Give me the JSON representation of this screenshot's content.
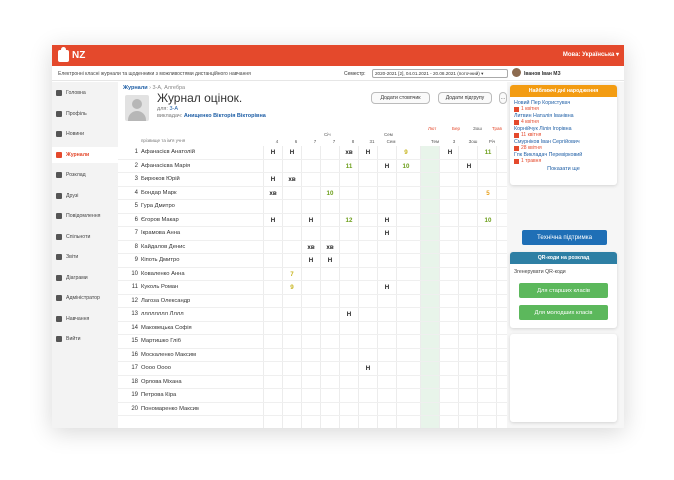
{
  "header": {
    "logo": "NZ",
    "language": "Мова: Українська ▾"
  },
  "subbar": {
    "info": "Електронні класні журнали та щоденники з можливостями дистанційного навчання",
    "semester_label": "Семестр:",
    "semester_value": "2020-2021 [2], 04.01.2021 - 20.08.2021 (поточний) ▾",
    "user": "Іванов Іван МЗ"
  },
  "sidebar": {
    "items": [
      {
        "label": "Головна",
        "icon": "home-icon"
      },
      {
        "label": "Профіль",
        "icon": "profile-icon"
      },
      {
        "label": "Новини",
        "icon": "news-icon"
      },
      {
        "label": "Журнали",
        "icon": "journal-icon",
        "active": true
      },
      {
        "label": "Розклад",
        "icon": "schedule-icon"
      },
      {
        "label": "Друзі",
        "icon": "friends-icon"
      },
      {
        "label": "Повідомлення",
        "icon": "messages-icon"
      },
      {
        "label": "Спільноти",
        "icon": "communities-icon"
      },
      {
        "label": "Звіти",
        "icon": "reports-icon"
      },
      {
        "label": "Діаграми",
        "icon": "diagrams-icon"
      },
      {
        "label": "Адміністратор",
        "icon": "admin-icon"
      },
      {
        "label": "Навчання",
        "icon": "learning-icon"
      },
      {
        "label": "Вийти",
        "icon": "logout-icon"
      }
    ]
  },
  "main": {
    "breadcrumb": {
      "link": "Журнали",
      "rest": " › 3-А, Алгебра"
    },
    "title": "Журнал оцінок.",
    "class_label": "для:",
    "class_value": "3-А",
    "teacher_label": "викладач:",
    "teacher_value": "Анищенко Вікторія Вікторівна",
    "buttons": {
      "add_column": "Додати стовпчик",
      "add_subgroup": "Додати підгрупу",
      "more": "Додатково... ▾"
    },
    "name_header": "прізвище та ім'я учня",
    "date_headers": [
      "4",
      "6",
      "7",
      "7",
      "8",
      "31",
      "Сем",
      "Тем",
      "3",
      "Зош",
      "Річ"
    ],
    "month_labels": [
      "Січ",
      "Сем",
      "Лют",
      "Бер",
      "Зош",
      "Трав"
    ],
    "students": [
      {
        "num": "1",
        "name": "Афанасієв Анатолій"
      },
      {
        "num": "2",
        "name": "Афанасієва Марія"
      },
      {
        "num": "3",
        "name": "Бирюков Юрій"
      },
      {
        "num": "4",
        "name": "Бондар Марк"
      },
      {
        "num": "5",
        "name": "Гура Дмитро"
      },
      {
        "num": "6",
        "name": "Єгоров Макар"
      },
      {
        "num": "7",
        "name": "Ікрамова Анна"
      },
      {
        "num": "8",
        "name": "Кайдалов Денис"
      },
      {
        "num": "9",
        "name": "Кіпоть Дмитро"
      },
      {
        "num": "10",
        "name": "Коваленко Анна"
      },
      {
        "num": "11",
        "name": "Куколь Роман"
      },
      {
        "num": "12",
        "name": "Лагоза Олександр"
      },
      {
        "num": "13",
        "name": "лллллллл Лллл"
      },
      {
        "num": "14",
        "name": "Маковецька Софія"
      },
      {
        "num": "15",
        "name": "Мартишко Гліб"
      },
      {
        "num": "16",
        "name": "Москаленко Максим"
      },
      {
        "num": "17",
        "name": "Оооо Оооо"
      },
      {
        "num": "18",
        "name": "Орлова Міхана"
      },
      {
        "num": "19",
        "name": "Петрова Кіра"
      },
      {
        "num": "20",
        "name": "Пономаренко Максим"
      }
    ],
    "marks": [
      {
        "row": 0,
        "col": 0,
        "v": "Н"
      },
      {
        "row": 0,
        "col": 1,
        "v": "Н"
      },
      {
        "row": 0,
        "col": 4,
        "v": "хв"
      },
      {
        "row": 0,
        "col": 5,
        "v": "Н"
      },
      {
        "row": 0,
        "col": 7,
        "v": "9"
      },
      {
        "row": 0,
        "col": 9,
        "v": "Н"
      },
      {
        "row": 0,
        "col": 11,
        "v": "11"
      },
      {
        "row": 1,
        "col": 4,
        "v": "11"
      },
      {
        "row": 1,
        "col": 6,
        "v": "Н"
      },
      {
        "row": 1,
        "col": 7,
        "v": "10"
      },
      {
        "row": 1,
        "col": 10,
        "v": "Н"
      },
      {
        "row": 2,
        "col": 0,
        "v": "Н"
      },
      {
        "row": 2,
        "col": 1,
        "v": "хв"
      },
      {
        "row": 3,
        "col": 0,
        "v": "хв"
      },
      {
        "row": 3,
        "col": 3,
        "v": "10"
      },
      {
        "row": 3,
        "col": 11,
        "v": "5"
      },
      {
        "row": 5,
        "col": 0,
        "v": "Н"
      },
      {
        "row": 5,
        "col": 2,
        "v": "Н"
      },
      {
        "row": 5,
        "col": 4,
        "v": "12"
      },
      {
        "row": 5,
        "col": 6,
        "v": "Н"
      },
      {
        "row": 5,
        "col": 11,
        "v": "10"
      },
      {
        "row": 6,
        "col": 6,
        "v": "Н"
      },
      {
        "row": 7,
        "col": 2,
        "v": "хв"
      },
      {
        "row": 7,
        "col": 3,
        "v": "хв"
      },
      {
        "row": 8,
        "col": 2,
        "v": "Н"
      },
      {
        "row": 8,
        "col": 3,
        "v": "Н"
      },
      {
        "row": 9,
        "col": 1,
        "v": "7"
      },
      {
        "row": 10,
        "col": 1,
        "v": "9"
      },
      {
        "row": 10,
        "col": 6,
        "v": "Н"
      },
      {
        "row": 12,
        "col": 4,
        "v": "Н"
      },
      {
        "row": 16,
        "col": 5,
        "v": "Н"
      }
    ]
  },
  "birthdays": {
    "title": "Найближчі дні народження",
    "people": [
      {
        "name": "Новий Пер Користувач",
        "date": "1 квітня"
      },
      {
        "name": "Литвин Наталія Іванівна",
        "date": "4 квітня"
      },
      {
        "name": "Корнійчук Лілія Ігорівна",
        "date": "11 квітня"
      },
      {
        "name": "Смурніков Іван Сергійович",
        "date": "28 квітня"
      },
      {
        "name": "Гпк Викладач Перевірковий",
        "date": "1 травня"
      }
    ],
    "more": "Показати ще"
  },
  "support": {
    "label": "Технічна підтримка"
  },
  "qr": {
    "title": "QR-коди на розклад",
    "text": "Згенерувати QR-коди",
    "older": "Для старших класів",
    "younger": "Для молодших класів"
  },
  "colors": {
    "brand": "#e4492c",
    "orange": "#f39c12",
    "blue": "#1f6fb6",
    "teal": "#2e7fa4",
    "green": "#5cb85c"
  }
}
